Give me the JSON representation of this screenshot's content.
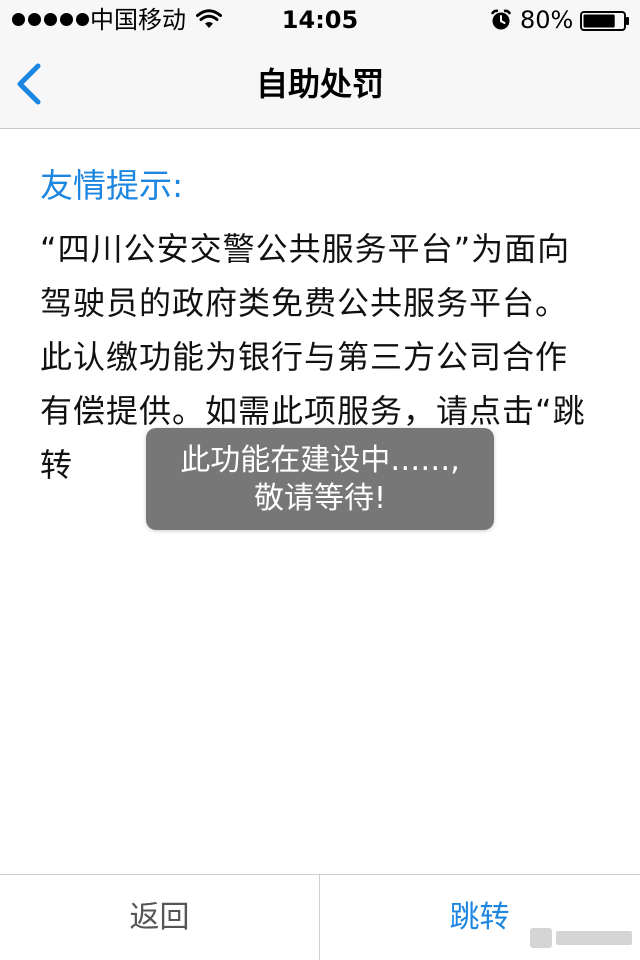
{
  "status_bar": {
    "carrier": "中国移动",
    "time": "14:05",
    "battery": "80%",
    "battery_level": 0.8,
    "signal_bars": 5,
    "icons": [
      "signal-dots-icon",
      "wifi-icon",
      "alarm-icon",
      "battery-icon"
    ]
  },
  "nav": {
    "title": "自助处罚",
    "back_icon": "chevron-left-icon"
  },
  "content": {
    "tip_title": "友情提示:",
    "tip_body": "“四川公安交警公共服务平台”为面向驾驶员的政府类免费公共服务平台。此认缴功能为银行与第三方公司合作有偿提供。如需此项服务，请点击“跳转"
  },
  "toast": {
    "line1": "此功能在建设中……,",
    "line2": "敬请等待!"
  },
  "bottom_bar": {
    "back_label": "返回",
    "jump_label": "跳转"
  },
  "colors": {
    "accent": "#1d86e0",
    "toast_bg": "#6e6e6e",
    "bar_bg": "#f7f7f7"
  }
}
